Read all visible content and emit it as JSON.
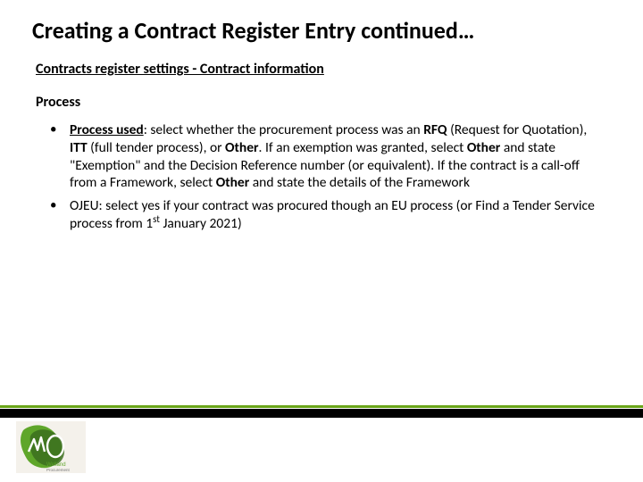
{
  "title": "Creating a Contract Register Entry continued…",
  "subtitle": "Contracts register settings - Contract information",
  "section": "Process",
  "bullets": {
    "b1_label": "Process used",
    "b1_t1": ": select whether the procurement process was an ",
    "b1_rfq": "RFQ",
    "b1_t2": " (Request for Quotation), ",
    "b1_itt": "ITT",
    "b1_t3": " (full tender process), or ",
    "b1_other1": "Other",
    "b1_t4": ". If an exemption was granted, select ",
    "b1_other2": "Other",
    "b1_t5": " and state \"Exemption\" and the Decision Reference number (or equivalent). If the contract is a call-off from a Framework, select ",
    "b1_other3": "Other",
    "b1_t6": " and state the details of the Framework",
    "b2_t1": "OJEU: select yes if your contract was procured though an EU process (or Find a Tender Service process from 1",
    "b2_sup": "st",
    "b2_t2": " January 2021)"
  },
  "logo_text": "Welland Procurement"
}
